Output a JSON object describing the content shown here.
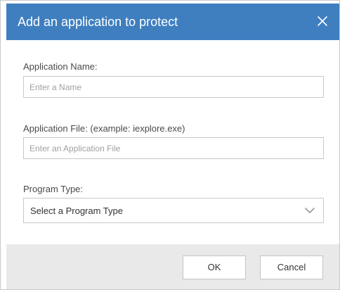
{
  "dialog": {
    "title": "Add an application to protect",
    "colors": {
      "header_bg": "#3f7fc0",
      "footer_bg": "#e9e9e9",
      "border": "#c8c8c8"
    }
  },
  "form": {
    "app_name": {
      "label": "Application Name:",
      "value": "",
      "placeholder": "Enter a Name"
    },
    "app_file": {
      "label": "Application File: (example: iexplore.exe)",
      "value": "",
      "placeholder": "Enter an Application File"
    },
    "program_type": {
      "label": "Program Type:",
      "selected": "Select a Program Type"
    }
  },
  "footer": {
    "ok_label": "OK",
    "cancel_label": "Cancel"
  },
  "icons": {
    "close": "close-icon",
    "dropdown": "chevron-down-icon"
  }
}
